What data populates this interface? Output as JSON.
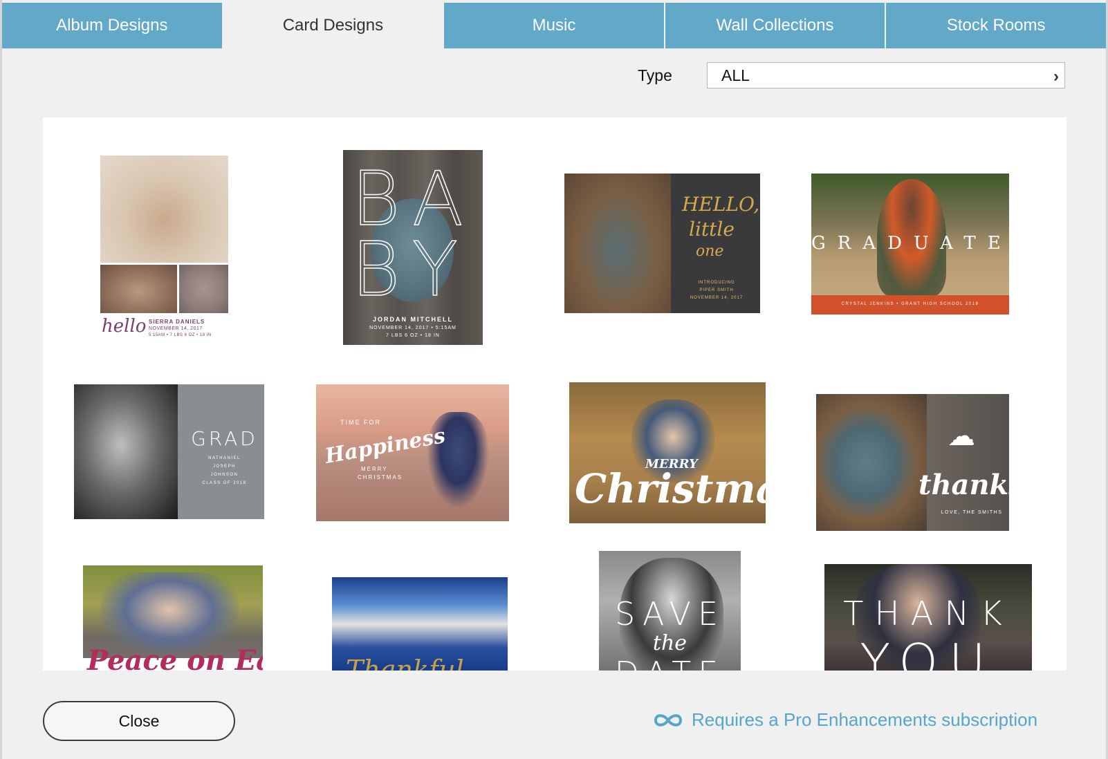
{
  "tabs": [
    {
      "label": "Album Designs",
      "active": false
    },
    {
      "label": "Card Designs",
      "active": true
    },
    {
      "label": "Music",
      "active": false
    },
    {
      "label": "Wall Collections",
      "active": false
    },
    {
      "label": "Stock Rooms",
      "active": false
    }
  ],
  "filter": {
    "label": "Type",
    "value": "ALL",
    "chevron": "›"
  },
  "cards": {
    "hello": {
      "script": "hello",
      "name": "SIERRA DANIELS",
      "meta1": "NOVEMBER 14, 2017",
      "meta2": "5:15AM • 7 LBS 6 OZ • 18 IN"
    },
    "baby": {
      "letters": [
        "B",
        "A",
        "B",
        "Y"
      ],
      "name": "JORDAN MITCHELL",
      "meta1": "NOVEMBER 14, 2017 • 5:15AM",
      "meta2": "7 LBS 6 OZ • 18 IN"
    },
    "hello_little_one": {
      "line1": "HELLO,",
      "line2": "little",
      "line3": "one",
      "intro1": "INTRODUCING",
      "intro2": "PIPER SMITH",
      "intro3": "NOVEMBER 14, 2017"
    },
    "graduate": {
      "word": "GRADUATE",
      "bar": "CRYSTAL JENKINS • GRANT HIGH SCHOOL 2018"
    },
    "grad": {
      "word": "GRAD",
      "n1": "NATHANIEL",
      "n2": "JOSEPH",
      "n3": "JOHNSON",
      "n4": "CLASS OF 2018"
    },
    "happiness": {
      "t1": "TIME FOR",
      "t2": "Happiness",
      "t3": "MERRY",
      "t4": "CHRISTMAS"
    },
    "christmas": {
      "merry": "MERRY",
      "xmas": "Christmas"
    },
    "thanks": {
      "cloud": "☁",
      "word": "thanks",
      "love": "LOVE, THE SMITHS"
    },
    "peace": {
      "text": "Peace on Earth"
    },
    "thankful": {
      "text": "Thankful"
    },
    "save_the_date": {
      "save": "SAVE",
      "the": "the",
      "date": "DATE"
    },
    "thank_you": {
      "thank": "THANK",
      "you": "YOU"
    }
  },
  "footer": {
    "close_label": "Close",
    "pro_note": "Requires a Pro Enhancements subscription",
    "pro_icon": "infinity-icon",
    "accent_color": "#55a6c9",
    "tab_color": "#62a8c8"
  }
}
